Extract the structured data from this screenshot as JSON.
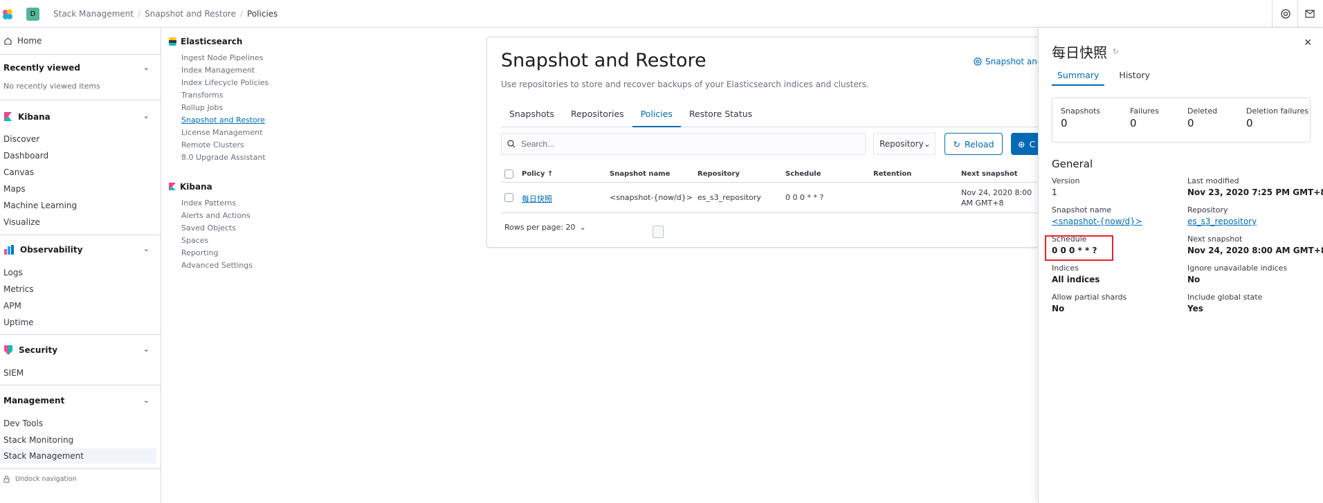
{
  "header": {
    "space_initial": "D",
    "breadcrumbs": [
      "Stack Management",
      "Snapshot and Restore",
      "Policies"
    ]
  },
  "nav": {
    "home": "Home",
    "recently_viewed": {
      "title": "Recently viewed",
      "empty": "No recently viewed items"
    },
    "kibana": {
      "title": "Kibana",
      "items": [
        "Discover",
        "Dashboard",
        "Canvas",
        "Maps",
        "Machine Learning",
        "Visualize"
      ]
    },
    "observability": {
      "title": "Observability",
      "items": [
        "Logs",
        "Metrics",
        "APM",
        "Uptime"
      ]
    },
    "security": {
      "title": "Security",
      "items": [
        "SIEM"
      ]
    },
    "management": {
      "title": "Management",
      "items": [
        "Dev Tools",
        "Stack Monitoring",
        "Stack Management"
      ]
    },
    "undock": "Undock navigation"
  },
  "subnav": {
    "elasticsearch": {
      "title": "Elasticsearch",
      "items": [
        "Ingest Node Pipelines",
        "Index Management",
        "Index Lifecycle Policies",
        "Transforms",
        "Rollup Jobs",
        "Snapshot and Restore",
        "License Management",
        "Remote Clusters",
        "8.0 Upgrade Assistant"
      ]
    },
    "kibana": {
      "title": "Kibana",
      "items": [
        "Index Patterns",
        "Alerts and Actions",
        "Saved Objects",
        "Spaces",
        "Reporting",
        "Advanced Settings"
      ]
    }
  },
  "main": {
    "title": "Snapshot and Restore",
    "description": "Use repositories to store and recover backups of your Elasticsearch indices and clusters.",
    "docs_link": "Snapshot and",
    "tabs": [
      "Snapshots",
      "Repositories",
      "Policies",
      "Restore Status"
    ],
    "search_placeholder": "Search...",
    "repo_filter": "Repository",
    "reload": "Reload",
    "create": "C",
    "table": {
      "columns": [
        "Policy",
        "Snapshot name",
        "Repository",
        "Schedule",
        "Retention",
        "Next snapshot"
      ],
      "rows": [
        {
          "policy": "每日快照",
          "snapshot_name": "<snapshot-{now/d}>",
          "repository": "es_s3_repository",
          "schedule": "0 0 0 * * ?",
          "retention": "",
          "next_snapshot_line1": "Nov 24, 2020 8:00",
          "next_snapshot_line2": "AM GMT+8"
        }
      ]
    },
    "rows_per_page": "Rows per page: 20"
  },
  "flyout": {
    "title": "每日快照",
    "tabs": [
      "Summary",
      "History"
    ],
    "stats": [
      {
        "label": "Snapshots",
        "value": "0"
      },
      {
        "label": "Failures",
        "value": "0"
      },
      {
        "label": "Deleted",
        "value": "0"
      },
      {
        "label": "Deletion failures",
        "value": "0"
      }
    ],
    "general_title": "General",
    "fields": {
      "version": {
        "label": "Version",
        "value": "1"
      },
      "last_modified": {
        "label": "Last modified",
        "value": "Nov 23, 2020 7:25 PM GMT+8"
      },
      "snapshot_name": {
        "label": "Snapshot name",
        "value": "<snapshot-{now/d}>"
      },
      "repository": {
        "label": "Repository",
        "value": "es_s3_repository"
      },
      "schedule": {
        "label": "Schedule",
        "value": "0 0 0 * * ?"
      },
      "next_snapshot": {
        "label": "Next snapshot",
        "value": "Nov 24, 2020 8:00 AM GMT+8"
      },
      "indices": {
        "label": "Indices",
        "value": "All indices"
      },
      "ignore_unavailable": {
        "label": "Ignore unavailable indices",
        "value": "No"
      },
      "partial_shards": {
        "label": "Allow partial shards",
        "value": "No"
      },
      "global_state": {
        "label": "Include global state",
        "value": "Yes"
      }
    }
  },
  "colors": {
    "accent": "#006bb4",
    "highlight": "#e7212b"
  }
}
